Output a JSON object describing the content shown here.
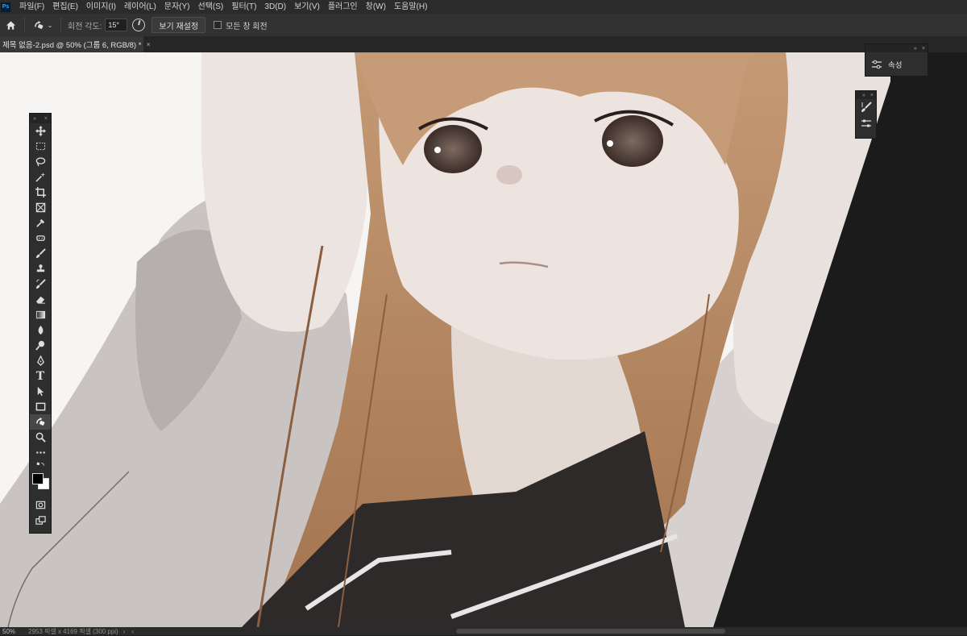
{
  "app": {
    "logo_text": "Ps"
  },
  "menu": [
    "파일(F)",
    "편집(E)",
    "이미지(I)",
    "레이어(L)",
    "문자(Y)",
    "선택(S)",
    "필터(T)",
    "3D(D)",
    "보기(V)",
    "플러그인",
    "창(W)",
    "도움말(H)"
  ],
  "options_bar": {
    "home_icon": "home-icon",
    "tool_icon": "rotate-view-icon",
    "angle_label": "회전 각도:",
    "angle_value": "15°",
    "reset_view_label": "보기 재설정",
    "rotate_all_label": "모든 창 회전",
    "rotate_all_checked": false
  },
  "document_tab": {
    "title": "제목 없음-2.psd @ 50% (그룹 6, RGB/8) *",
    "close": "×"
  },
  "status_bar": {
    "zoom": "50%",
    "doc_info": "2953 픽셀 x 4169 픽셀 (300 ppi)",
    "arrow": "›",
    "arrow_left": "‹"
  },
  "toolbar": {
    "collapse": "»",
    "close": "×",
    "tools": [
      "move-icon",
      "marquee-icon",
      "lasso-icon",
      "magic-wand-icon",
      "crop-icon",
      "frame-icon",
      "eyedropper-icon",
      "healing-brush-icon",
      "brush-icon",
      "clone-stamp-icon",
      "history-brush-icon",
      "eraser-icon",
      "gradient-icon",
      "blur-icon",
      "dodge-icon",
      "pen-icon",
      "type-icon",
      "path-selection-icon",
      "rectangle-icon",
      "rotate-view-icon",
      "zoom-icon",
      "more-icon"
    ],
    "active_tool": "rotate-view-icon",
    "type_glyph": "T",
    "foreground_color": "#000000",
    "background_color": "#ffffff"
  },
  "properties_panel": {
    "label": "속성",
    "icon": "properties-icon"
  },
  "brush_panel": {
    "icons": [
      "brush-settings-icon",
      "adjustments-icon"
    ]
  },
  "colors": {
    "app_bg": "#1e1e1e",
    "menu_bg": "#2b2b2b",
    "options_bg": "#323232",
    "panel_bg": "#2e2e2e",
    "canvas_bg": "#1b1b1b"
  }
}
